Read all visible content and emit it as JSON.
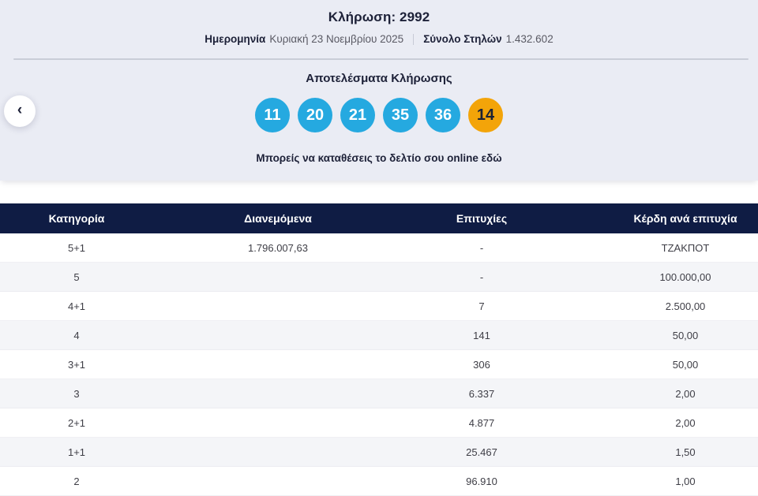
{
  "hero": {
    "draw_title": "Κλήρωση: 2992",
    "date_label": "Ημερομηνία",
    "date_value": "Κυριακή 23 Νοεμβρίου 2025",
    "columns_label": "Σύνολο Στηλών",
    "columns_value": "1.432.602",
    "results_title": "Αποτελέσματα Κλήρωσης",
    "numbers": [
      "11",
      "20",
      "21",
      "35",
      "36"
    ],
    "bonus_number": "14",
    "online_link": "Μπορείς να καταθέσεις το δελτίο σου online εδώ",
    "back_arrow": "‹"
  },
  "colors": {
    "page_bg": "#eaecf4",
    "ball_blue": "#25a9e0",
    "ball_yellow": "#f3a409",
    "header_navy": "#0f1c44",
    "text_navy": "#1d2138"
  },
  "table": {
    "headers": [
      "Κατηγορία",
      "Διανεμόμενα",
      "Επιτυχίες",
      "Κέρδη ανά επιτυχία"
    ],
    "rows": [
      {
        "category": "5+1",
        "distributed": "1.796.007,63",
        "winners": "-",
        "prize": "ΤΖΑΚΠΟΤ"
      },
      {
        "category": "5",
        "distributed": "",
        "winners": "-",
        "prize": "100.000,00"
      },
      {
        "category": "4+1",
        "distributed": "",
        "winners": "7",
        "prize": "2.500,00"
      },
      {
        "category": "4",
        "distributed": "",
        "winners": "141",
        "prize": "50,00"
      },
      {
        "category": "3+1",
        "distributed": "",
        "winners": "306",
        "prize": "50,00"
      },
      {
        "category": "3",
        "distributed": "",
        "winners": "6.337",
        "prize": "2,00"
      },
      {
        "category": "2+1",
        "distributed": "",
        "winners": "4.877",
        "prize": "2,00"
      },
      {
        "category": "1+1",
        "distributed": "",
        "winners": "25.467",
        "prize": "1,50"
      },
      {
        "category": "2",
        "distributed": "",
        "winners": "96.910",
        "prize": "1,00"
      }
    ]
  }
}
